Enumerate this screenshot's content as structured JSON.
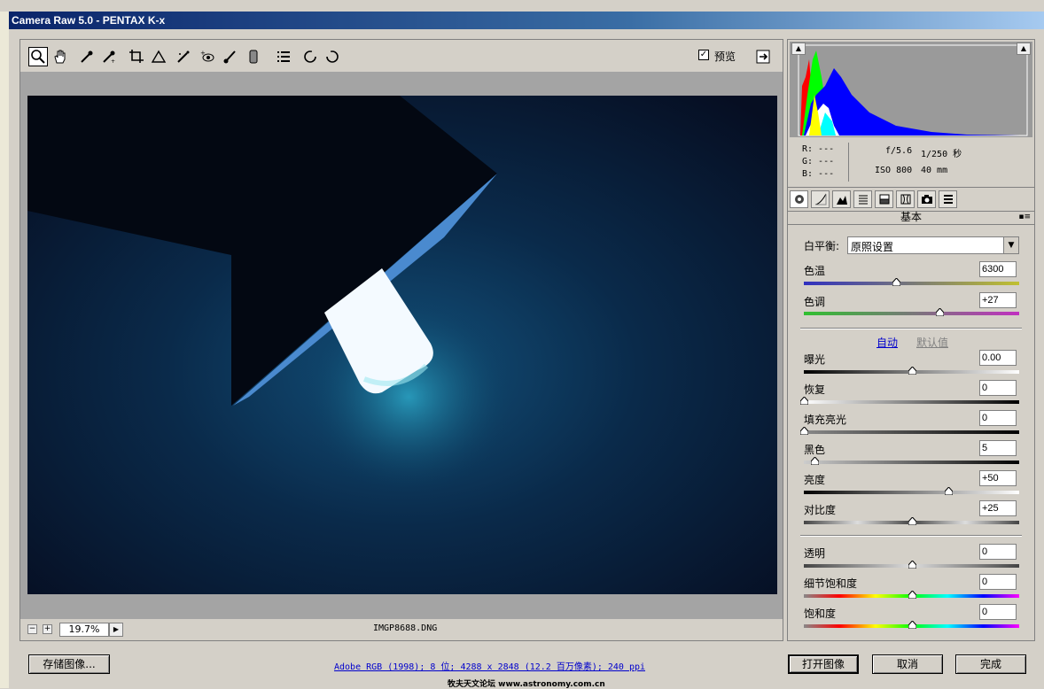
{
  "window": {
    "title": "Camera Raw 5.0 -  PENTAX K-x"
  },
  "toolbar": {
    "tools": [
      "zoom-tool",
      "hand-tool",
      "white-balance-tool",
      "color-sampler-tool",
      "crop-tool",
      "straighten-tool",
      "spot-removal-tool",
      "red-eye-tool",
      "adjustment-brush-tool",
      "graduated-filter-tool",
      "preferences-tool",
      "rotate-left-tool",
      "rotate-right-tool"
    ],
    "preview_label": "预览",
    "preview_checked": true
  },
  "status": {
    "zoom": "19.7%",
    "filename": "IMGP8688.DNG"
  },
  "info": {
    "r": "R:  ---",
    "g": "G:  ---",
    "b": "B:  ---",
    "aperture": "f/5.6",
    "shutter": "1/250 秒",
    "iso": "ISO 800",
    "focal": "40 mm"
  },
  "panel": {
    "title": "基本",
    "white_balance_label": "白平衡:",
    "white_balance_value": "原照设置",
    "temp_label": "色温",
    "temp_value": "6300",
    "temp_level": 0.43,
    "tint_label": "色调",
    "tint_value": "+27",
    "tint_level": 0.63,
    "auto_label": "自动",
    "default_label": "默认值",
    "exposure_label": "曝光",
    "exposure_value": "0.00",
    "exposure_level": 0.5,
    "recovery_label": "恢复",
    "recovery_value": "0",
    "recovery_level": 0.0,
    "fill_label": "填充亮光",
    "fill_value": "0",
    "fill_level": 0.0,
    "blacks_label": "黑色",
    "blacks_value": "5",
    "blacks_level": 0.05,
    "brightness_label": "亮度",
    "brightness_value": "+50",
    "brightness_level": 0.67,
    "contrast_label": "对比度",
    "contrast_value": "+25",
    "contrast_level": 0.5,
    "clarity_label": "透明",
    "clarity_value": "0",
    "clarity_level": 0.5,
    "vibrance_label": "细节饱和度",
    "vibrance_value": "0",
    "vibrance_level": 0.5,
    "saturation_label": "饱和度",
    "saturation_value": "0",
    "saturation_level": 0.5
  },
  "footer": {
    "save_label": "存储图像...",
    "workflow_text": "Adobe RGB (1998); 8 位; 4288 x 2848 (12.2 百万像素); 240 ppi",
    "open_label": "打开图像",
    "cancel_label": "取消",
    "done_label": "完成",
    "watermark": "牧夫天文论坛 www.astronomy.com.cn"
  }
}
